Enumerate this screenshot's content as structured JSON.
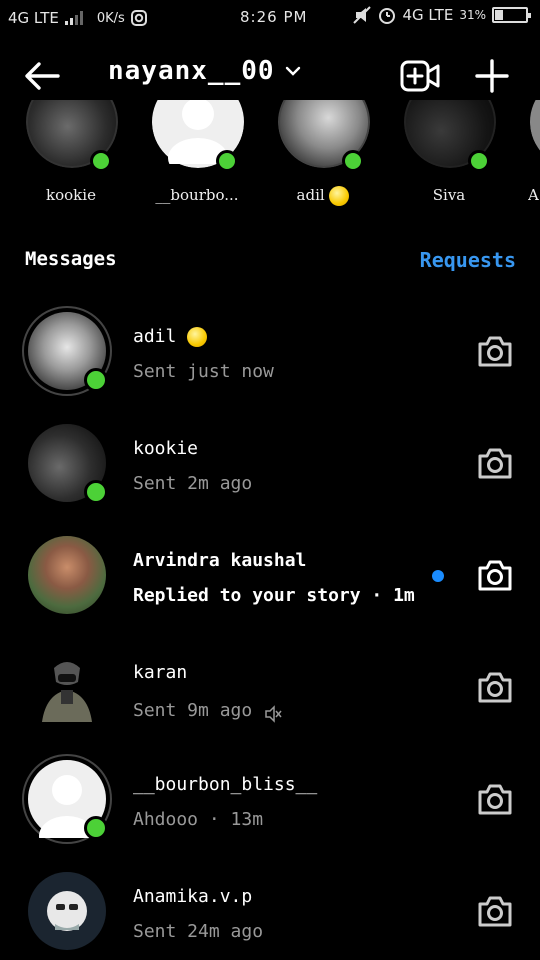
{
  "status_bar": {
    "left_network": "4G LTE",
    "speed": "0K/s",
    "time": "8:26 PM",
    "right_network": "4G LTE",
    "battery": "31%"
  },
  "header": {
    "username": "nayanx__00"
  },
  "stories": [
    {
      "label": "kookie",
      "online": true
    },
    {
      "label": "__bourbo...",
      "online": true
    },
    {
      "label": "adil",
      "online": true,
      "emoji": "lollipop"
    },
    {
      "label": "Siva",
      "online": true
    },
    {
      "label": "A",
      "online": false
    }
  ],
  "section": {
    "messages_label": "Messages",
    "requests_label": "Requests"
  },
  "conversations": [
    {
      "name": "adil",
      "sub": "Sent just now",
      "online": true,
      "unread": false,
      "emoji": "lollipop",
      "muted": false
    },
    {
      "name": "kookie",
      "sub": "Sent 2m ago",
      "online": true,
      "unread": false,
      "muted": false
    },
    {
      "name": "Arvindra kaushal",
      "sub": "Replied to your story · 1m",
      "online": false,
      "unread": true,
      "muted": false
    },
    {
      "name": "karan",
      "sub": "Sent 9m ago",
      "online": false,
      "unread": false,
      "muted": true
    },
    {
      "name": "__bourbon_bliss__",
      "sub": "Ahdooo · 13m",
      "online": true,
      "unread": false,
      "muted": false
    },
    {
      "name": "Anamika.v.p",
      "sub": "Sent 24m ago",
      "online": false,
      "unread": false,
      "muted": false
    }
  ],
  "colors": {
    "accent": "#3897f0",
    "online": "#4cd137",
    "unread_dot": "#1a8cff",
    "background": "#000000"
  },
  "icons": [
    "back-arrow-icon",
    "chevron-down-icon",
    "new-video-room-icon",
    "new-message-plus-icon",
    "camera-icon",
    "muted-speaker-icon"
  ]
}
